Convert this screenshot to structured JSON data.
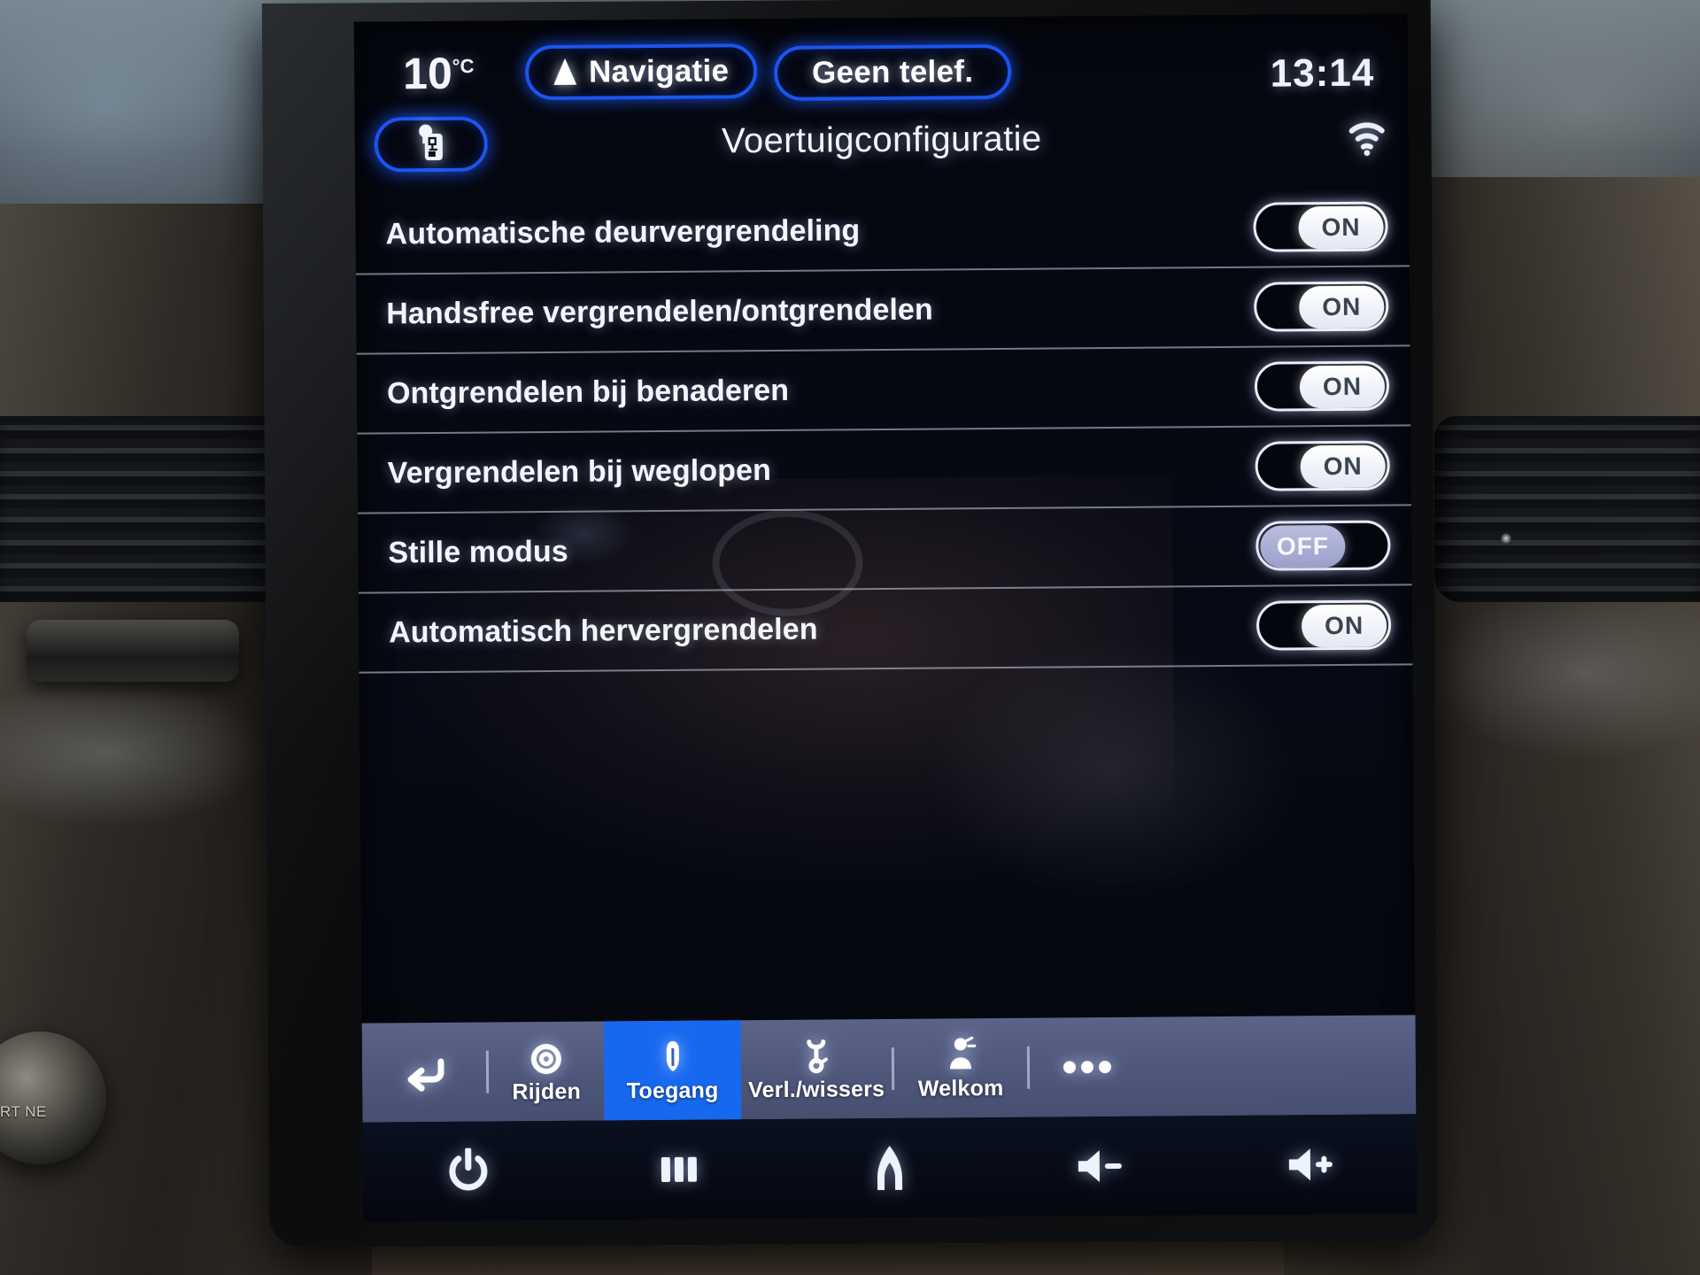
{
  "statusbar": {
    "temperature": "10",
    "temperature_unit": "°C",
    "nav_label": "Navigatie",
    "nav_icon": "navigation-arrow-icon",
    "phone_label": "Geen telef.",
    "clock": "13:14"
  },
  "title_row": {
    "gear_icon": "gear-shifter-icon",
    "title": "Voertuigconfiguratie",
    "wifi_icon": "wifi-signal-icon"
  },
  "settings": {
    "rows": [
      {
        "label": "Automatische deurvergrendeling",
        "state": "ON"
      },
      {
        "label": "Handsfree vergrendelen/ontgrendelen",
        "state": "ON"
      },
      {
        "label": "Ontgrendelen bij benaderen",
        "state": "ON"
      },
      {
        "label": "Vergrendelen bij weglopen",
        "state": "ON"
      },
      {
        "label": "Stille modus",
        "state": "OFF"
      },
      {
        "label": "Automatisch hervergrendelen",
        "state": "ON"
      }
    ]
  },
  "category_bar": {
    "back_icon": "back-arrow-icon",
    "items": [
      {
        "label": "Rijden",
        "icon": "steering-wheel-icon",
        "active": false
      },
      {
        "label": "Toegang",
        "icon": "car-lock-icon",
        "active": true
      },
      {
        "label": "Verl./wissers",
        "icon": "wiper-light-icon",
        "active": false
      },
      {
        "label": "Welkom",
        "icon": "welcome-person-icon",
        "active": false
      }
    ],
    "more_icon": "more-dots-icon"
  },
  "system_bar": {
    "buttons": [
      {
        "icon": "power-icon"
      },
      {
        "icon": "apps-grid-icon"
      },
      {
        "icon": "home-icon"
      },
      {
        "icon": "volume-down-icon"
      },
      {
        "icon": "volume-up-icon"
      }
    ]
  },
  "colors": {
    "accent_blue": "#1b55f0",
    "active_tile": "#1668ef",
    "catbar_bg": "#4e567a",
    "screen_bg": "#05070f",
    "text": "#f4f6fb",
    "toggle_off_pill": "#9aa0c8"
  },
  "surroundings": {
    "knob_text": "RT NE"
  }
}
